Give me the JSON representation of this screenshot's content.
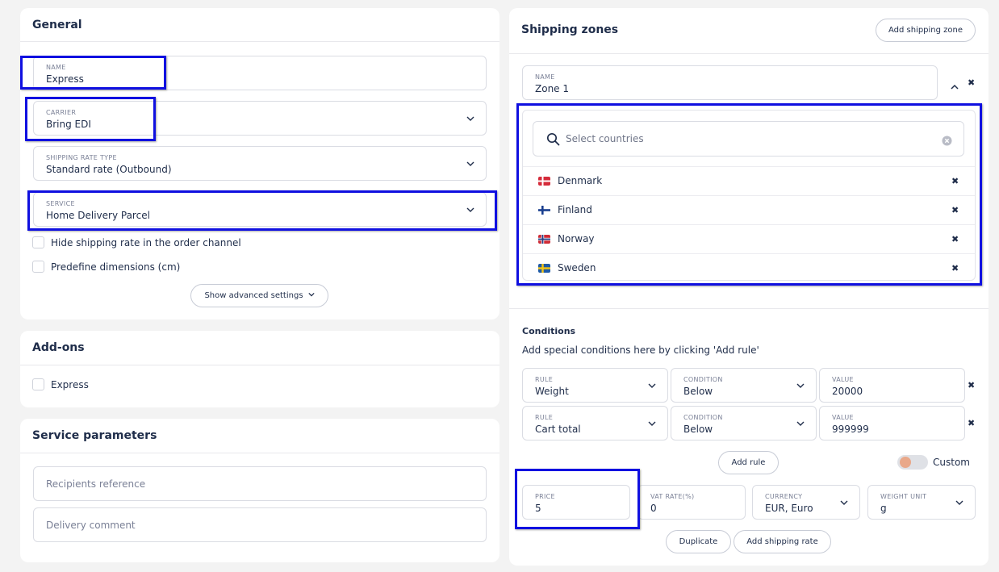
{
  "general": {
    "title": "General",
    "name": {
      "label": "NAME",
      "value": "Express"
    },
    "carrier": {
      "label": "CARRIER",
      "value": "Bring EDI"
    },
    "rate_type": {
      "label": "SHIPPING RATE TYPE",
      "value": "Standard rate (Outbound)"
    },
    "service": {
      "label": "SERVICE",
      "value": "Home Delivery Parcel"
    },
    "hide_rate_label": "Hide shipping rate in the order channel",
    "predefine_label": "Predefine dimensions (cm)",
    "advanced_button": "Show advanced settings"
  },
  "addons": {
    "title": "Add-ons",
    "express_label": "Express"
  },
  "service_params": {
    "title": "Service parameters",
    "recipients_placeholder": "Recipients reference",
    "delivery_placeholder": "Delivery comment"
  },
  "zones": {
    "title": "Shipping zones",
    "add_zone_button": "Add shipping zone",
    "zone_name": {
      "label": "NAME",
      "value": "Zone 1"
    },
    "country_search_placeholder": "Select countries",
    "countries": [
      {
        "name": "Denmark",
        "flag": "dk"
      },
      {
        "name": "Finland",
        "flag": "fi"
      },
      {
        "name": "Norway",
        "flag": "no"
      },
      {
        "name": "Sweden",
        "flag": "se"
      }
    ]
  },
  "conditions": {
    "title": "Conditions",
    "hint": "Add special conditions here by clicking 'Add rule'",
    "rules": [
      {
        "rule_label": "RULE",
        "rule": "Weight",
        "condition_label": "CONDITION",
        "condition": "Below",
        "value_label": "VALUE",
        "value": "20000"
      },
      {
        "rule_label": "RULE",
        "rule": "Cart total",
        "condition_label": "CONDITION",
        "condition": "Below",
        "value_label": "VALUE",
        "value": "999999"
      }
    ],
    "add_rule_button": "Add rule",
    "custom_label": "Custom",
    "custom_enabled": false
  },
  "rate": {
    "price": {
      "label": "PRICE",
      "value": "5"
    },
    "vat": {
      "label": "VAT RATE(%)",
      "value": "0"
    },
    "currency": {
      "label": "CURRENCY",
      "value": "EUR, Euro"
    },
    "weight_unit": {
      "label": "WEIGHT UNIT",
      "value": "g"
    },
    "duplicate_button": "Duplicate",
    "add_rate_button": "Add shipping rate"
  },
  "colors": {
    "highlight": "#1010e0",
    "text": "#1f2d4a",
    "toggle_knob": "#e9a88a"
  }
}
